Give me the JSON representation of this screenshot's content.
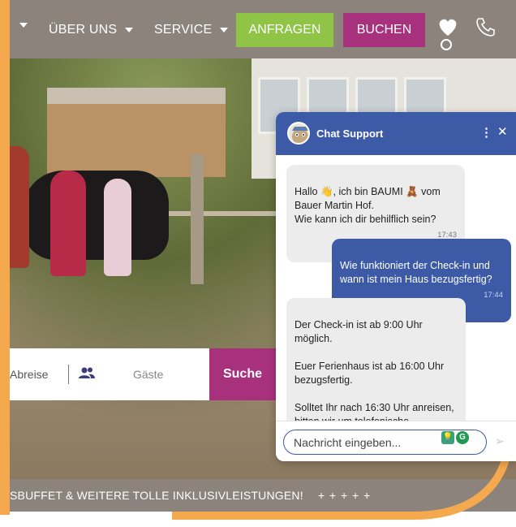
{
  "nav": {
    "items": [
      {
        "label": ""
      },
      {
        "label": "ÜBER UNS"
      },
      {
        "label": "SERVICE"
      }
    ],
    "anfragen_label": "ANFRAGEN",
    "buchen_label": "BUCHEN",
    "icons": [
      "heart-icon",
      "phone-icon"
    ]
  },
  "search": {
    "abreise_label": "Abreise",
    "gaeste_label": "Gäste",
    "submit_label": "Suche",
    "guest_icon": "guests-icon"
  },
  "banner": {
    "text": "SBUFFET & WEITERE TOLLE INKLUSIVLEISTUNGEN!",
    "plus": "+ + + + +"
  },
  "chat": {
    "title": "Chat Support",
    "menu_label": "⋮",
    "close_label": "✕",
    "messages": [
      {
        "from": "bot",
        "text": "Hallo 👋, ich bin BAUMI 🧸 vom\nBauer Martin Hof.\nWie kann ich dir behilflich sein?",
        "time": "17:43"
      },
      {
        "from": "user",
        "text": "Wie funktioniert der Check-in und\nwann ist mein Haus bezugsfertig?",
        "time": "17:44"
      },
      {
        "from": "bot",
        "text": "Der Check-in ist ab 9:00 Uhr\nmöglich.\n\nEuer Ferienhaus ist ab 16:00 Uhr\nbezugsfertig.\n\nSolltet Ihr nach 16:30 Uhr anreisen,\nbitten wir um telefonische\nAnmeldung.",
        "time": ""
      }
    ],
    "input_placeholder": "Nachricht eingeben...",
    "send_label": "➢"
  },
  "colors": {
    "nav_bg": "#8c847c",
    "anfragen": "#8fc447",
    "buchen": "#a8317e",
    "chat_blue": "#3c5aa6",
    "accent_orange": "#f4a94e"
  }
}
